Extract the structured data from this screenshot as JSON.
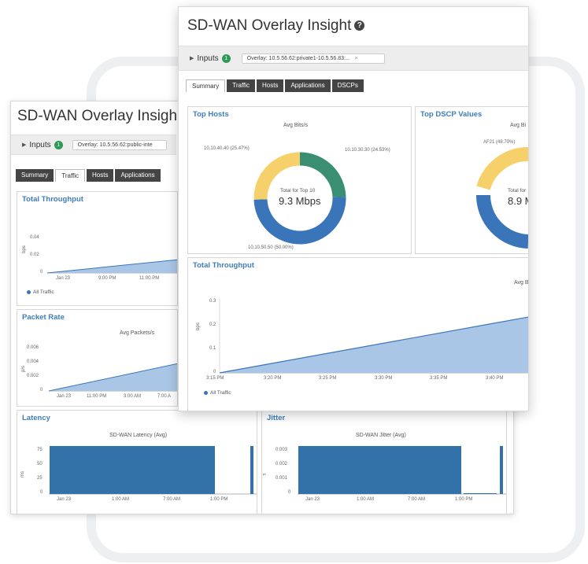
{
  "colors": {
    "accent": "#3d7dbd",
    "series_blue": "#3b75b9",
    "area_fill": "#aac6e6",
    "green": "#2e9a55",
    "yellow": "#f6d16b",
    "teal": "#3a8f72",
    "tab_dark": "#444444"
  },
  "back_window": {
    "title": "SD-WAN Overlay Insigh",
    "inputs_label": "Inputs",
    "inputs_count": "1",
    "input_chip": "Overlay: 10.5.56.62:public-inte",
    "tabs": [
      "Summary",
      "Traffic",
      "Hosts",
      "Applications"
    ],
    "active_tab": "Traffic",
    "total_throughput": {
      "title": "Total Throughput",
      "y_label": "bps",
      "y_ticks": [
        "0.04",
        "0.02",
        "0"
      ],
      "x_ticks": [
        "Jan 23",
        "9:00 PM",
        "11:00 PM"
      ],
      "legend": "All Traffic"
    },
    "packet_rate": {
      "title": "Packet Rate",
      "subtitle": "Avg Packets/s",
      "y_label": "p/s",
      "y_ticks": [
        "0.006",
        "0.004",
        "0.002",
        "0"
      ],
      "x_ticks": [
        "Jan 23",
        "11:00 PM",
        "3:00 AM",
        "7:00 A"
      ]
    },
    "latency": {
      "title": "Latency",
      "subtitle": "SD-WAN Latency (Avg)",
      "y_label": "ms",
      "y_ticks": [
        "75",
        "50",
        "25",
        "0"
      ],
      "x_ticks": [
        "Jan 23",
        "1:00 AM",
        "7:00 AM",
        "1:00 PM"
      ]
    },
    "jitter": {
      "title": "Jitter",
      "subtitle": "SD-WAN Jitter (Avg)",
      "y_label": "s",
      "y_ticks": [
        "0.003",
        "0.002",
        "0.001",
        "0"
      ],
      "x_ticks": [
        "Jan 23",
        "1:00 AM",
        "7:00 AM",
        "1:00 PM"
      ]
    }
  },
  "front_window": {
    "title": "SD-WAN Overlay Insight",
    "help_glyph": "?",
    "inputs_label": "Inputs",
    "inputs_count": "1",
    "input_chip": "Overlay: 10.5.56.62:private1-10.5.56.83:...",
    "chip_close": "×",
    "tabs": [
      "Summary",
      "Traffic",
      "Hosts",
      "Applications",
      "DSCPs"
    ],
    "active_tab": "Summary",
    "top_hosts": {
      "title": "Top Hosts",
      "subtitle": "Avg Bits/s",
      "center_label": "Total for Top 10",
      "center_value": "9.3 Mbps",
      "slices": [
        {
          "label": "10.10.30.30 (24.53%)",
          "percent": 24.53,
          "color": "#3a8f72"
        },
        {
          "label": "10.10.50.50 (50.00%)",
          "percent": 50.0,
          "color": "#3b75b9"
        },
        {
          "label": "10.10.40.40 (25.47%)",
          "percent": 25.47,
          "color": "#f6d16b"
        }
      ]
    },
    "top_dscp": {
      "title": "Top DSCP Values",
      "subtitle": "Avg Bi",
      "center_label": "Total for",
      "center_value": "8.9 M",
      "slice_label": "AF21 (48.70%)"
    },
    "total_throughput": {
      "title": "Total Throughput",
      "subtitle": "Avg B",
      "y_label": "bps",
      "y_ticks": [
        "0.3",
        "0.2",
        "0.1",
        "0"
      ],
      "x_ticks": [
        "3:15 PM",
        "3:20 PM",
        "3:25 PM",
        "3:30 PM",
        "3:35 PM",
        "3:40 PM"
      ],
      "legend": "All Traffic"
    }
  }
}
